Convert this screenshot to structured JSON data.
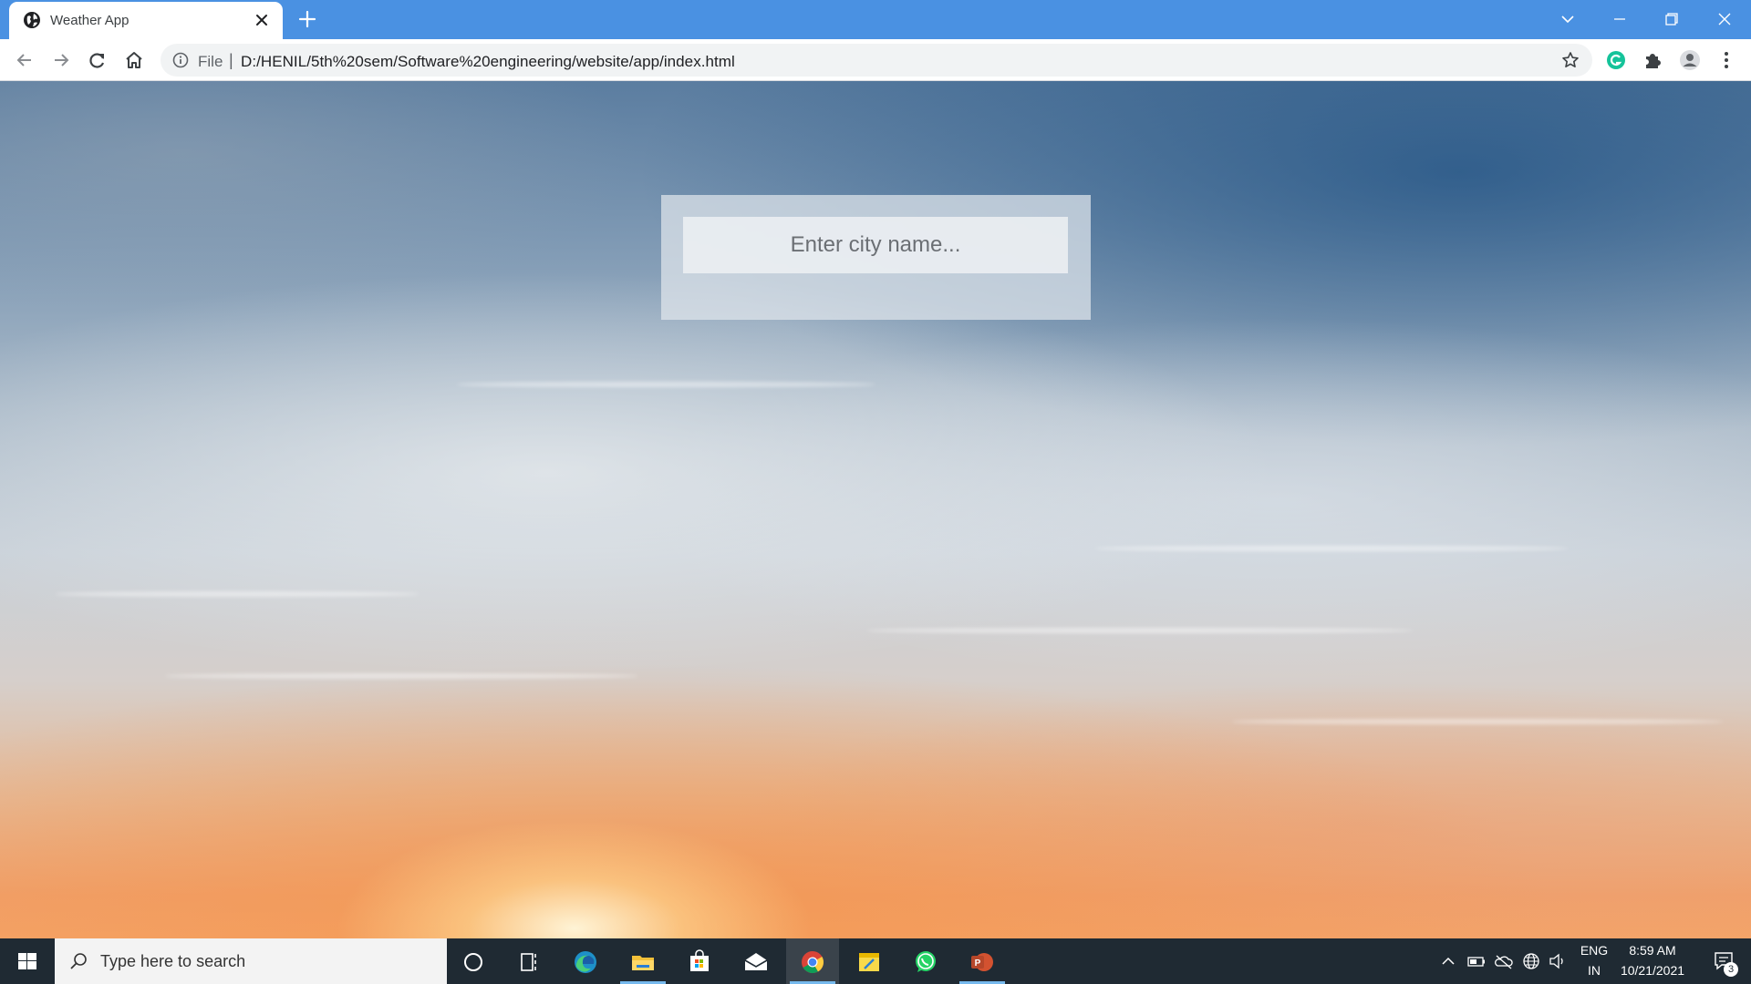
{
  "browser": {
    "tab": {
      "title": "Weather App"
    },
    "address": {
      "scheme_label": "File",
      "separator": "|",
      "url": "D:/HENIL/5th%20sem/Software%20engineering/website/app/index.html"
    },
    "colors": {
      "tabstrip": "#4a91e2",
      "toolbar": "#ffffff",
      "omnibox": "#f1f3f4"
    }
  },
  "page": {
    "city_input": {
      "placeholder": "Enter city name...",
      "value": ""
    }
  },
  "taskbar": {
    "search_placeholder": "Type here to search",
    "pinned": [
      "cortana-icon",
      "task-view-icon",
      "edge-icon",
      "file-explorer-icon",
      "store-icon",
      "mail-icon",
      "chrome-icon",
      "sticky-notes-icon",
      "whatsapp-icon",
      "powerpoint-icon"
    ],
    "tray": {
      "language": "ENG",
      "region": "IN",
      "time": "8:59 AM",
      "date": "10/21/2021",
      "notification_count": "3"
    }
  }
}
